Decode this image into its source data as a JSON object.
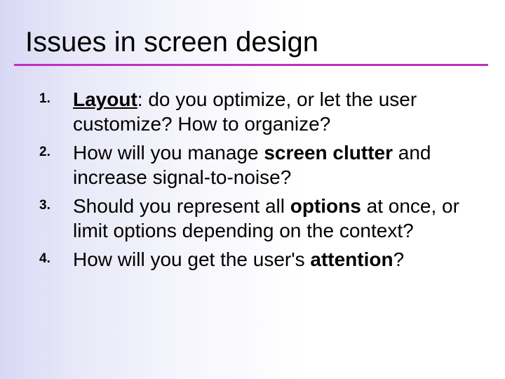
{
  "title": "Issues in screen design",
  "items": [
    {
      "num": "1.",
      "runs": [
        {
          "text": "Layout",
          "bold": true,
          "underline": true
        },
        {
          "text": ": do you optimize, or let the user customize?  How to organize?",
          "bold": false,
          "underline": false
        }
      ]
    },
    {
      "num": "2.",
      "runs": [
        {
          "text": "How will you manage ",
          "bold": false,
          "underline": false
        },
        {
          "text": "screen clutter",
          "bold": true,
          "underline": false
        },
        {
          "text": " and increase signal-to-noise?",
          "bold": false,
          "underline": false
        }
      ]
    },
    {
      "num": "3.",
      "runs": [
        {
          "text": "Should you represent all ",
          "bold": false,
          "underline": false
        },
        {
          "text": "options",
          "bold": true,
          "underline": false
        },
        {
          "text": " at once, or limit options depending on the context?",
          "bold": false,
          "underline": false
        }
      ]
    },
    {
      "num": "4.",
      "runs": [
        {
          "text": "How will you get the user's ",
          "bold": false,
          "underline": false
        },
        {
          "text": "attention",
          "bold": true,
          "underline": false
        },
        {
          "text": "?",
          "bold": false,
          "underline": false
        }
      ]
    }
  ]
}
